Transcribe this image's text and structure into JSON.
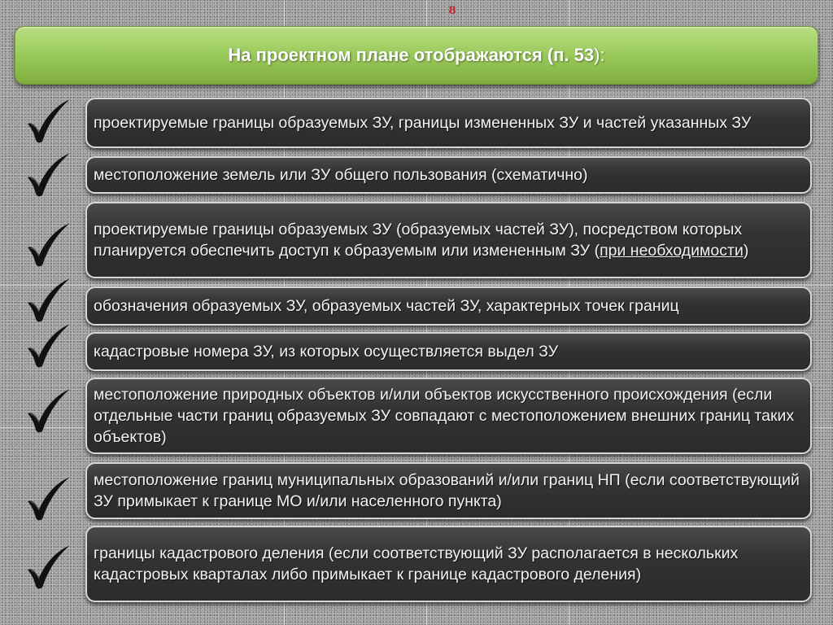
{
  "page_number": "8",
  "title": {
    "prefix": "На проектном плане отображаются (п. 53",
    "suffix": "):"
  },
  "icons": {
    "bullet": "checkmark-icon"
  },
  "items": [
    {
      "text": "проектируемые границы образуемых ЗУ, границы измененных ЗУ и частей указанных ЗУ"
    },
    {
      "text": "местоположение земель или ЗУ общего пользования (схематично)"
    },
    {
      "text": "проектируемые границы образуемых ЗУ (образуемых частей ЗУ), посредством которых планируется обеспечить доступ к образуемым или измененным ЗУ (",
      "underlined": "при необходимости",
      "tail": ")"
    },
    {
      "text": "обозначения образуемых ЗУ, образуемых частей ЗУ, характерных точек границ"
    },
    {
      "text": "кадастровые номера ЗУ, из которых осуществляется выдел ЗУ"
    },
    {
      "text": "местоположение природных объектов и/или объектов искусственного происхождения (если отдельные части границ образуемых ЗУ совпадают с местоположением внешних границ таких объектов)"
    },
    {
      "text": "местоположение границ муниципальных образований и/или границ НП (если соответствующий ЗУ примыкает к границе МО и/или населенного пункта)"
    },
    {
      "text": "границы кадастрового деления (если соответствующий ЗУ располагается в нескольких кадастровых кварталах либо примыкает к границе кадастрового деления)"
    }
  ]
}
